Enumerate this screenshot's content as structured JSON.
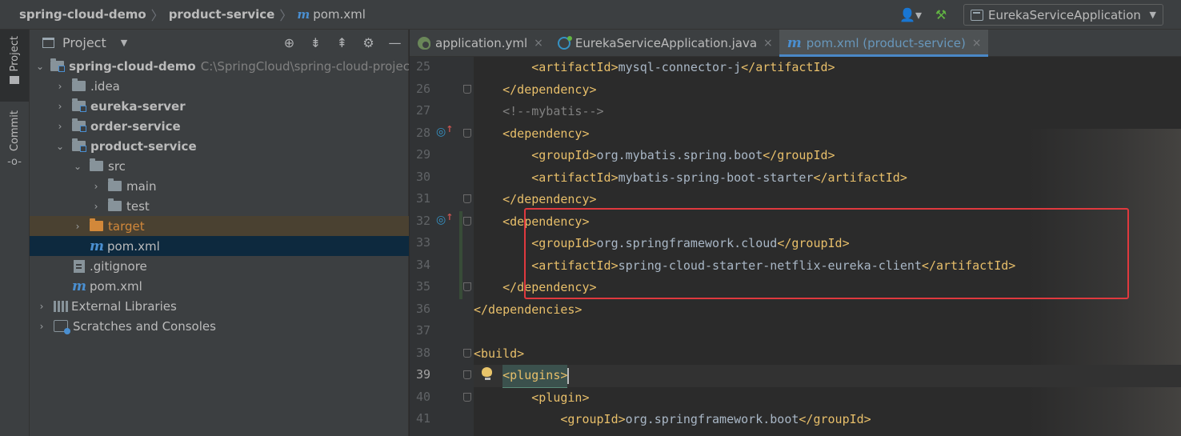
{
  "breadcrumb": {
    "project": "spring-cloud-demo",
    "module": "product-service",
    "file_icon": "m",
    "file": "pom.xml"
  },
  "toolbar": {
    "run_config": "EurekaServiceApplication",
    "icons": [
      "user-switch-icon",
      "hammer-icon",
      "app-config-icon"
    ]
  },
  "stripe": {
    "project_label": "Project",
    "commit_label": "Commit"
  },
  "project_panel": {
    "title": "Project",
    "tools": [
      "crosshair-icon",
      "expand-all-icon",
      "collapse-all-icon",
      "gear-icon",
      "minimize-icon"
    ],
    "tree": [
      {
        "label": "spring-cloud-demo",
        "path": "C:\\SpringCloud\\spring-cloud-project",
        "expanded": true,
        "bold": true
      },
      {
        "label": ".idea",
        "expanded": false
      },
      {
        "label": "eureka-server",
        "expanded": false,
        "bold": true
      },
      {
        "label": "order-service",
        "expanded": false,
        "bold": true
      },
      {
        "label": "product-service",
        "expanded": true,
        "bold": true
      },
      {
        "label": "src",
        "expanded": true
      },
      {
        "label": "main",
        "expanded": false
      },
      {
        "label": "test",
        "expanded": false
      },
      {
        "label": "target",
        "expanded": false
      },
      {
        "label": "pom.xml",
        "icon": "m"
      },
      {
        "label": ".gitignore"
      },
      {
        "label": "pom.xml",
        "icon": "m"
      },
      {
        "label": "External Libraries",
        "expanded": false
      },
      {
        "label": "Scratches and Consoles",
        "expanded": false
      }
    ]
  },
  "tabs": [
    {
      "label": "application.yml",
      "close": "×"
    },
    {
      "label": "EurekaServiceApplication.java",
      "close": "×"
    },
    {
      "label": "pom.xml (product-service)",
      "close": "×",
      "active": true
    }
  ],
  "editor": {
    "lines": [
      {
        "n": "25",
        "code": "        <artifactId>mysql-connector-j</artifactId>"
      },
      {
        "n": "26",
        "code": "    </dependency>"
      },
      {
        "n": "27",
        "code": "    <!--mybatis-->"
      },
      {
        "n": "28",
        "code": "    <dependency>"
      },
      {
        "n": "29",
        "code": "        <groupId>org.mybatis.spring.boot</groupId>"
      },
      {
        "n": "30",
        "code": "        <artifactId>mybatis-spring-boot-starter</artifactId>"
      },
      {
        "n": "31",
        "code": "    </dependency>"
      },
      {
        "n": "32",
        "code": "    <dependency>"
      },
      {
        "n": "33",
        "code": "        <groupId>org.springframework.cloud</groupId>"
      },
      {
        "n": "34",
        "code": "        <artifactId>spring-cloud-starter-netflix-eureka-client</artifactId>"
      },
      {
        "n": "35",
        "code": "    </dependency>"
      },
      {
        "n": "36",
        "code": "</dependencies>"
      },
      {
        "n": "37",
        "code": ""
      },
      {
        "n": "38",
        "code": "<build>"
      },
      {
        "n": "39",
        "code": "    <plugins>"
      },
      {
        "n": "40",
        "code": "        <plugin>"
      },
      {
        "n": "41",
        "code": "            <groupId>org.springframework.boot</groupId>"
      }
    ],
    "current_line": "39"
  },
  "colors": {
    "tag": "#e8bf6a",
    "text": "#a9b7c6",
    "comment": "#808080",
    "annotation_box": "#e0393e",
    "accent": "#4a88c7"
  }
}
